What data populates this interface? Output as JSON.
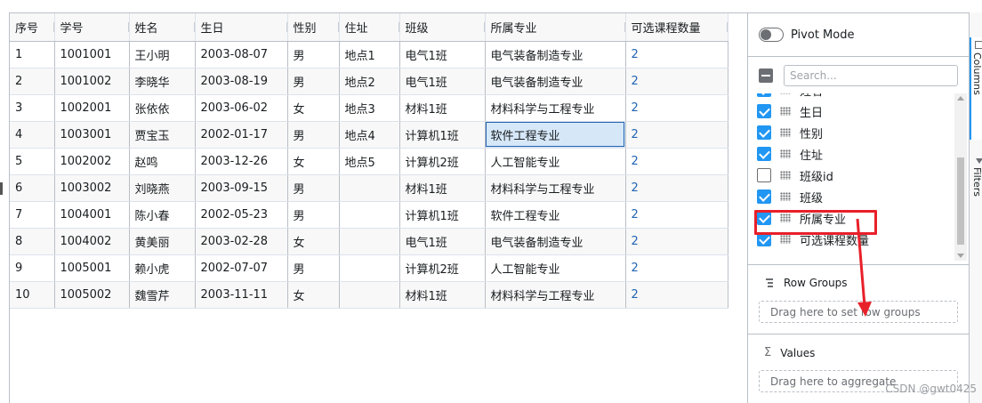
{
  "grid": {
    "columns": [
      "序号",
      "学号",
      "姓名",
      "生日",
      "性别",
      "住址",
      "班级",
      "所属专业",
      "可选课程数量"
    ],
    "rows": [
      [
        "1",
        "1001001",
        "王小明",
        "2003-08-07",
        "男",
        "地点1",
        "电气1班",
        "电气装备制造专业",
        "2"
      ],
      [
        "2",
        "1001002",
        "李晓华",
        "2003-08-19",
        "男",
        "地点2",
        "电气1班",
        "电气装备制造专业",
        "2"
      ],
      [
        "3",
        "1002001",
        "张依依",
        "2003-06-02",
        "女",
        "地点3",
        "材料1班",
        "材料科学与工程专业",
        "2"
      ],
      [
        "4",
        "1003001",
        "贾宝玉",
        "2002-01-17",
        "男",
        "地点4",
        "计算机1班",
        "软件工程专业",
        "2"
      ],
      [
        "5",
        "1002002",
        "赵鸣",
        "2003-12-26",
        "女",
        "地点5",
        "计算机2班",
        "人工智能专业",
        "2"
      ],
      [
        "6",
        "1003002",
        "刘晓燕",
        "2003-09-15",
        "男",
        "",
        "材料1班",
        "材料科学与工程专业",
        "2"
      ],
      [
        "7",
        "1004001",
        "陈小春",
        "2002-05-23",
        "男",
        "",
        "计算机1班",
        "软件工程专业",
        "2"
      ],
      [
        "8",
        "1004002",
        "黄美丽",
        "2003-02-28",
        "女",
        "",
        "电气1班",
        "电气装备制造专业",
        "2"
      ],
      [
        "9",
        "1005001",
        "赖小虎",
        "2002-07-07",
        "男",
        "",
        "计算机2班",
        "人工智能专业",
        "2"
      ],
      [
        "10",
        "1005002",
        "魏雪芹",
        "2003-11-11",
        "女",
        "",
        "材料1班",
        "材料科学与工程专业",
        "2"
      ]
    ],
    "selected_cell": {
      "row": 3,
      "col": 7
    }
  },
  "side_panel": {
    "pivot_label": "Pivot Mode",
    "search_placeholder": "Search...",
    "column_items": [
      {
        "label": "姓名",
        "checked": true
      },
      {
        "label": "生日",
        "checked": true
      },
      {
        "label": "性别",
        "checked": true
      },
      {
        "label": "住址",
        "checked": true
      },
      {
        "label": "班级id",
        "checked": false
      },
      {
        "label": "班级",
        "checked": true
      },
      {
        "label": "所属专业",
        "checked": true
      },
      {
        "label": "可选课程数量",
        "checked": true
      }
    ],
    "row_groups_title": "Row Groups",
    "row_groups_drop": "Drag here to set row groups",
    "values_title": "Values",
    "values_drop": "Drag here to aggregate"
  },
  "tabs": {
    "columns_label": "Columns",
    "filters_label": "Filters"
  },
  "watermark": "CSDN @gwt0425",
  "colors": {
    "accent": "#2196f3",
    "link": "#2264b3",
    "highlight": "#e8202a"
  }
}
